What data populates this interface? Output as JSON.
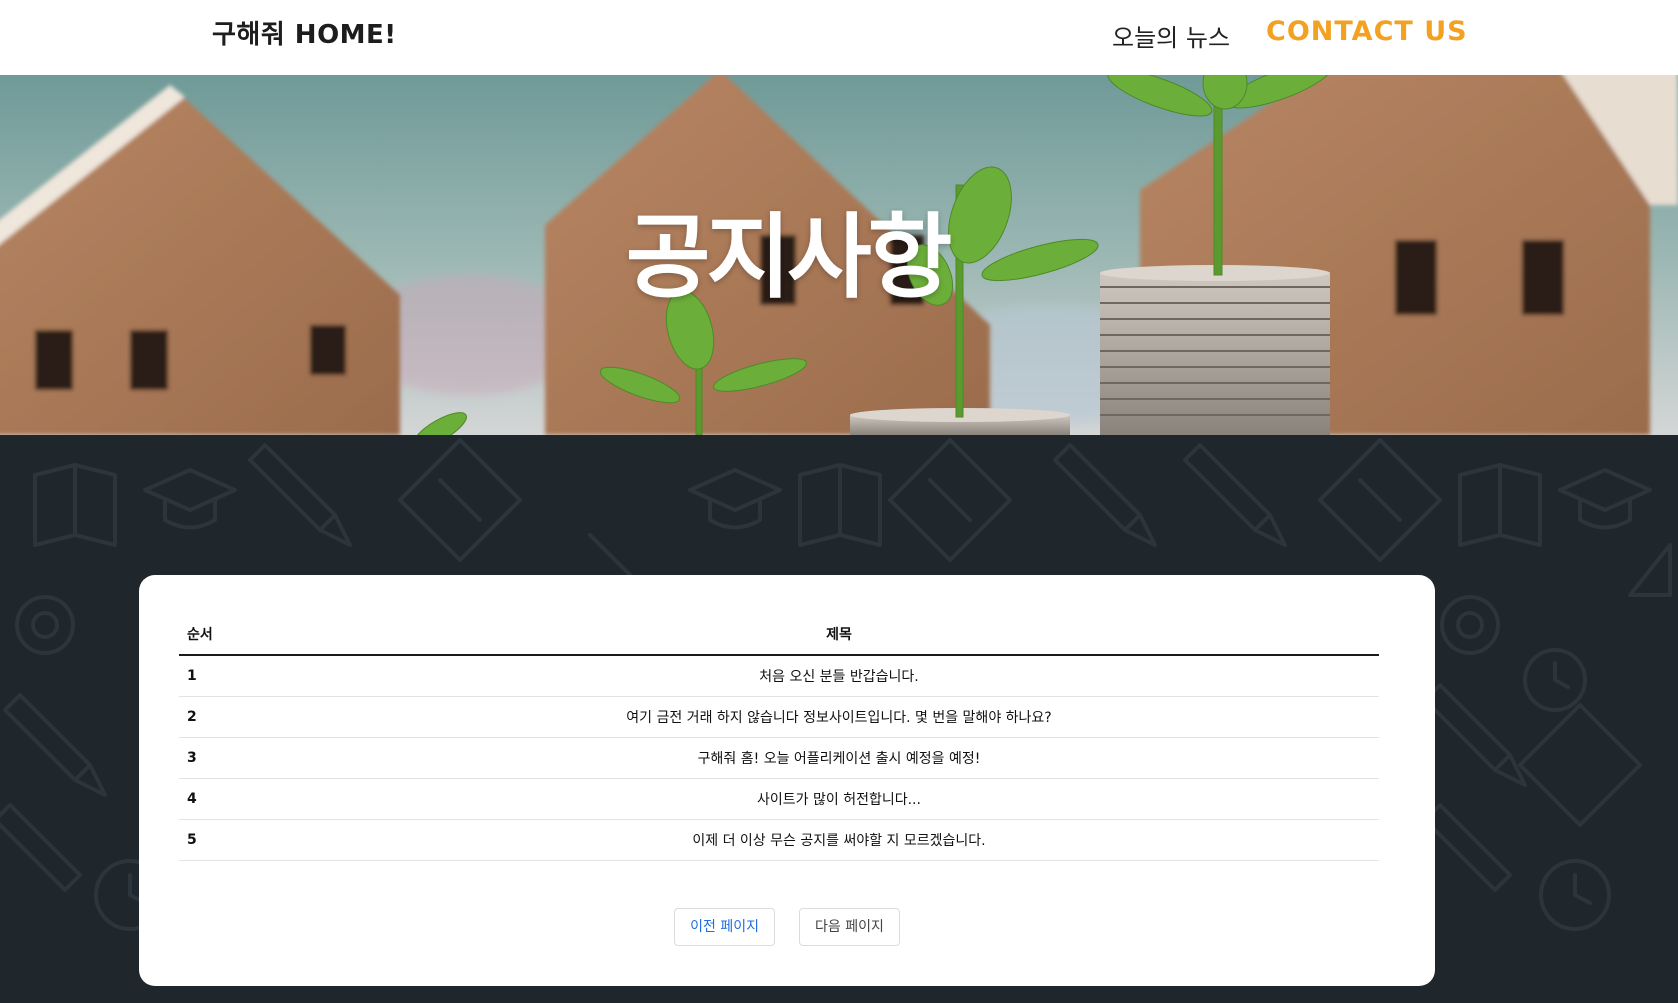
{
  "header": {
    "logo": "구해줘 HOME!",
    "nav": [
      {
        "label": "오늘의 뉴스"
      },
      {
        "label": "CONTACT US"
      }
    ]
  },
  "hero": {
    "title": "공지사항"
  },
  "notice_table": {
    "columns": [
      "순서",
      "제목"
    ],
    "rows": [
      {
        "num": "1",
        "title": "처음 오신 분들 반갑습니다."
      },
      {
        "num": "2",
        "title": "여기 금전 거래 하지 않습니다 정보사이트입니다. 몇 번을 말해야 하나요?"
      },
      {
        "num": "3",
        "title": "구해줘 홈! 오늘 어플리케이션 출시 예정을 예정!"
      },
      {
        "num": "4",
        "title": "사이트가 많이 허전합니다..."
      },
      {
        "num": "5",
        "title": "이제 더 이상 무슨 공지를 써야할 지 모르겠습니다."
      }
    ]
  },
  "pager": {
    "prev_label": "이전 페이지",
    "next_label": "다음 페이지"
  },
  "colors": {
    "accent": "#f3a121",
    "link_blue": "#1f6fe0",
    "dark_bg": "#1f262c"
  }
}
